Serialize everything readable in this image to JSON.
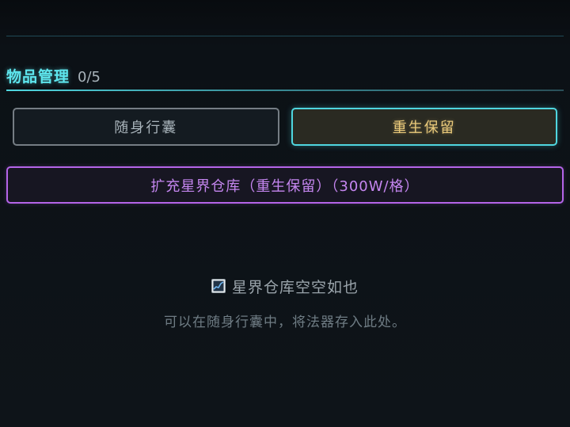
{
  "section": {
    "title": "物品管理",
    "count": "0/5"
  },
  "tabs": [
    {
      "label": "随身行囊",
      "active": false
    },
    {
      "label": "重生保留",
      "active": true
    }
  ],
  "expand_button": {
    "label": "扩充星界仓库（重生保留）（300W/格）"
  },
  "empty_state": {
    "icon": "chart-icon",
    "title": "星界仓库空空如也",
    "hint": "可以在随身行囊中，将法器存入此处。"
  },
  "colors": {
    "accent_cyan": "#4fd6df",
    "active_text_gold": "#e9c97a",
    "expand_purple": "#b464e8",
    "background": "#0d1117"
  }
}
